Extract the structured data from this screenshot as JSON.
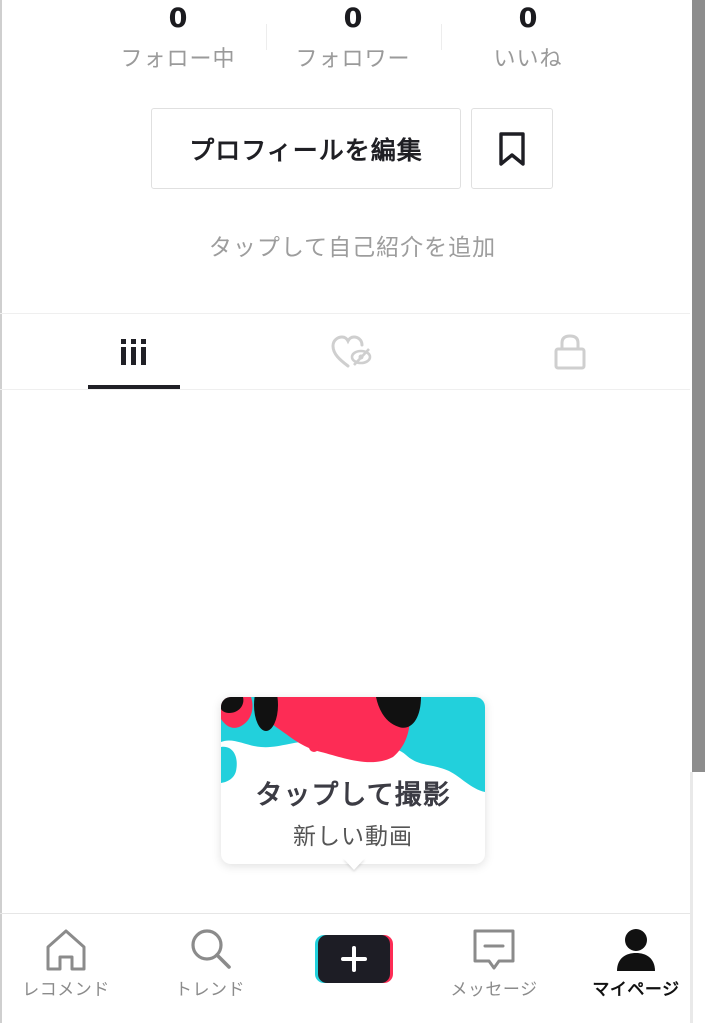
{
  "stats": [
    {
      "value": "0",
      "label": "フォロー中"
    },
    {
      "value": "0",
      "label": "フォロワー"
    },
    {
      "value": "0",
      "label": "いいね"
    }
  ],
  "profile": {
    "edit_label": "プロフィールを編集",
    "bookmark_icon": "bookmark-icon",
    "bio_placeholder": "タップして自己紹介を追加"
  },
  "tabs": [
    {
      "icon": "grid-icon",
      "active": true
    },
    {
      "icon": "liked-hidden-icon",
      "active": false
    },
    {
      "icon": "lock-icon",
      "active": false
    }
  ],
  "popup": {
    "title": "タップして撮影",
    "subtitle": "新しい動画"
  },
  "nav": [
    {
      "icon": "home-icon",
      "label": "レコメンド",
      "active": false
    },
    {
      "icon": "search-icon",
      "label": "トレンド",
      "active": false
    },
    {
      "icon": "add-icon",
      "label": "",
      "active": false
    },
    {
      "icon": "message-icon",
      "label": "メッセージ",
      "active": false
    },
    {
      "icon": "profile-icon",
      "label": "マイページ",
      "active": true
    }
  ],
  "colors": {
    "cyan": "#22d0dc",
    "pink": "#fd2c55",
    "dark": "#1d1d25",
    "muted": "#9d9d9d"
  }
}
